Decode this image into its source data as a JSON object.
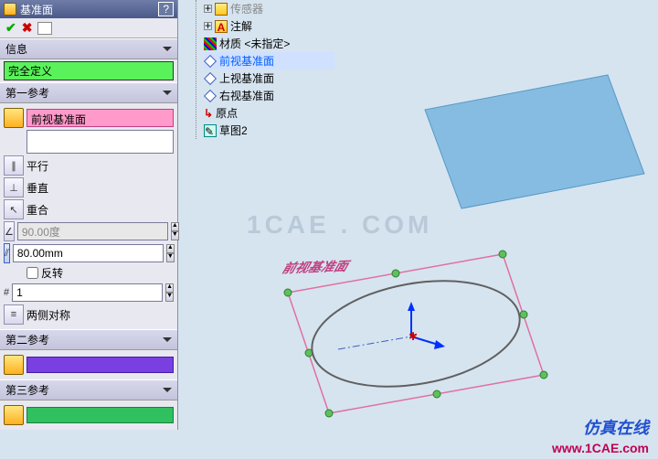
{
  "panel": {
    "title": "基准面",
    "help": "?",
    "sections": {
      "info": "信息",
      "status": "完全定义",
      "ref1": "第一参考",
      "ref2": "第二参考",
      "ref3": "第三参考"
    },
    "ref1": {
      "selection": "前视基准面",
      "parallel": "平行",
      "perp": "垂直",
      "coincident": "重合",
      "angle": "90.00度",
      "dist": "80.00mm",
      "flip": "反转",
      "count": "1",
      "midplane": "两侧对称"
    }
  },
  "tree": {
    "n0": "传感器",
    "n1": "注解",
    "n2": "材质 <未指定>",
    "n3": "前视基准面",
    "n4": "上视基准面",
    "n5": "右视基准面",
    "n6": "原点",
    "n7": "草图2"
  },
  "view": {
    "label3d": "前视基准面"
  },
  "watermark": {
    "center": "1CAE . COM",
    "brand": "仿真在线",
    "url": "www.1CAE.com"
  }
}
